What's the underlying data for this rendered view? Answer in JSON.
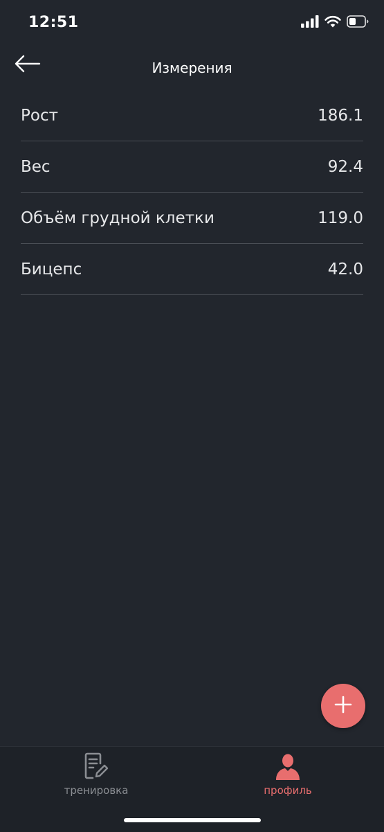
{
  "status_bar": {
    "time": "12:51",
    "icons": [
      "signal-icon",
      "wifi-icon",
      "battery-icon"
    ]
  },
  "header": {
    "title": "Измерения",
    "back_icon": "arrow-left-icon"
  },
  "measurements": [
    {
      "label": "Рост",
      "value": "186.1"
    },
    {
      "label": "Вес",
      "value": "92.4"
    },
    {
      "label": "Объём грудной клетки",
      "value": "119.0"
    },
    {
      "label": "Бицепс",
      "value": "42.0"
    }
  ],
  "fab": {
    "icon": "plus-icon",
    "color": "#e86e6e"
  },
  "tab_bar": {
    "tabs": [
      {
        "label": "тренировка",
        "icon": "document-edit-icon",
        "active": false,
        "color": "#8b8e93"
      },
      {
        "label": "профиль",
        "icon": "user-icon",
        "active": true,
        "color": "#e86e6e"
      }
    ]
  },
  "colors": {
    "background": "#22262d",
    "accent": "#e86e6e",
    "divider": "#4a4e55"
  }
}
